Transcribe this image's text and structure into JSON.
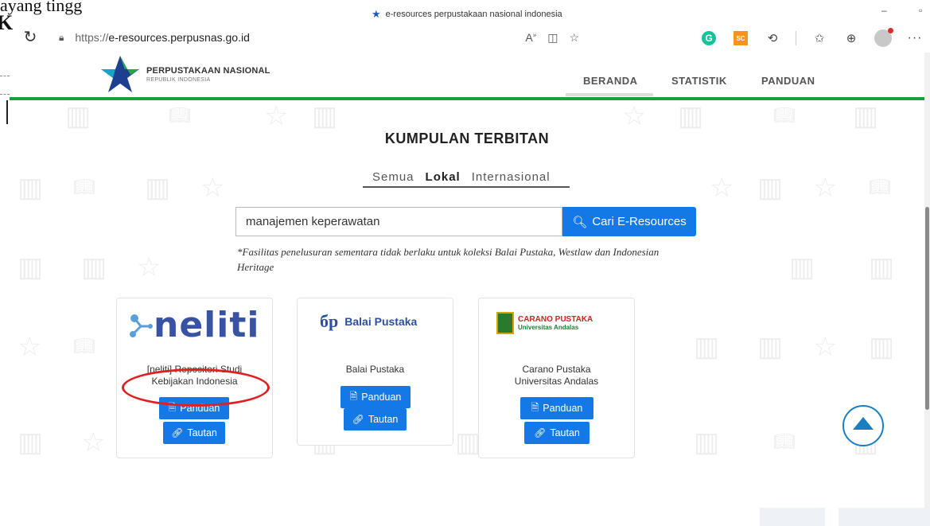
{
  "background_doc": {
    "text": "ayang tingg",
    "letter": "K"
  },
  "titlebar": {
    "tab_title": "e-resources perpustakaan nasional indonesia"
  },
  "addressbar": {
    "url_scheme": "https://",
    "url_host": "e-resources.perpusnas.go.id"
  },
  "toolbar": {
    "grammarly": "G",
    "sc_label": "SC"
  },
  "site": {
    "logo_title": "PERPUSTAKAAN NASIONAL",
    "logo_subtitle": "REPUBLIK INDONESIA",
    "nav": [
      "BERANDA",
      "STATISTIK",
      "PANDUAN"
    ]
  },
  "main": {
    "heading": "KUMPULAN TERBITAN",
    "tabs": [
      "Semua",
      "Lokal",
      "Internasional"
    ],
    "search_value": "manajemen keperawatan",
    "search_button": "Cari E-Resources",
    "notice": "*Fasilitas penelusuran sementara tidak berlaku untuk koleksi Balai Pustaka, Westlaw dan Indonesian Heritage"
  },
  "cards": [
    {
      "logo_text": "neliti",
      "title_line1": "[neliti] Repositori Studi",
      "title_line2": "Kebijakan Indonesia",
      "guide_label": "Panduan",
      "link_label": "Tautan"
    },
    {
      "logo_mark": "бр",
      "logo_text": "Balai Pustaka",
      "title_line1": "Balai Pustaka",
      "guide_label": "Panduan",
      "link_label": "Tautan"
    },
    {
      "logo_text": "CARANO PUSTAKA",
      "logo_subtext": "Universitas Andalas",
      "title_line1": "Carano Pustaka",
      "title_line2": "Universitas Andalas",
      "guide_label": "Panduan",
      "link_label": "Tautan"
    }
  ],
  "colors": {
    "accent_blue": "#1479e6",
    "green_rule": "#1a9f3a",
    "annotation_red": "#e02020"
  }
}
